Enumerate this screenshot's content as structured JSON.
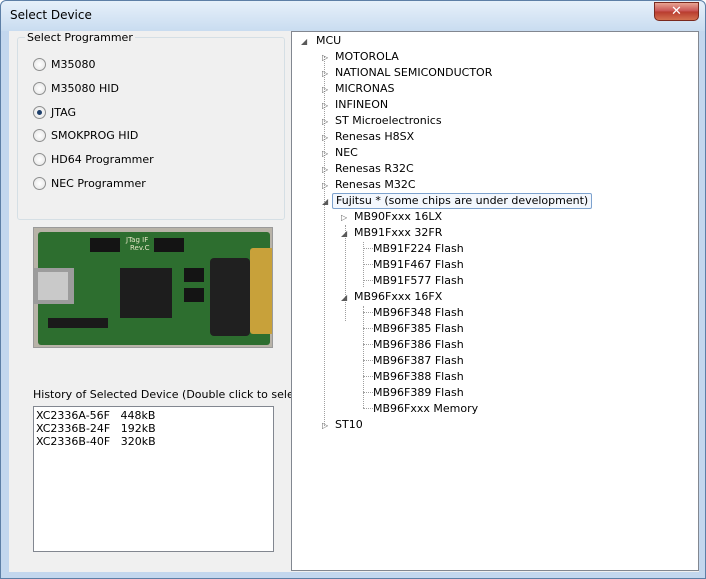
{
  "window": {
    "title": "Select Device",
    "close_label": "✕"
  },
  "programmer": {
    "group_label": "Select Programmer",
    "options": [
      {
        "label": "M35080",
        "checked": false
      },
      {
        "label": "M35080 HID",
        "checked": false
      },
      {
        "label": "JTAG",
        "checked": true
      },
      {
        "label": "SMOKPROG HID",
        "checked": false
      },
      {
        "label": "HD64 Programmer",
        "checked": false
      },
      {
        "label": "NEC Programmer",
        "checked": false
      }
    ]
  },
  "board_image": {
    "label": "JTag IF",
    "sublabel": "Rev.C"
  },
  "history": {
    "label": "History of Selected Device (Double click to select)",
    "items": [
      "XC2336A-56F   448kB",
      "XC2336B-24F   192kB",
      "XC2336B-40F   320kB"
    ]
  },
  "tree": {
    "root": "MCU",
    "manufacturers": [
      "MOTOROLA",
      "NATIONAL SEMICONDUCTOR",
      "MICRONAS",
      "INFINEON",
      "ST Microelectronics",
      "Renesas H8SX",
      "NEC",
      "Renesas R32C",
      "Renesas M32C"
    ],
    "fujitsu": "Fujitsu * (some chips are under development)",
    "fujitsu_children": {
      "mb90": "MB90Fxxx 16LX",
      "mb91": "MB91Fxxx 32FR",
      "mb91_items": [
        "MB91F224 Flash",
        "MB91F467 Flash",
        "MB91F577 Flash"
      ],
      "mb96": "MB96Fxxx 16FX",
      "mb96_items": [
        "MB96F348 Flash",
        "MB96F385 Flash",
        "MB96F386 Flash",
        "MB96F387 Flash",
        "MB96F388 Flash",
        "MB96F389 Flash",
        "MB96Fxxx Memory"
      ]
    },
    "last": "ST10"
  }
}
